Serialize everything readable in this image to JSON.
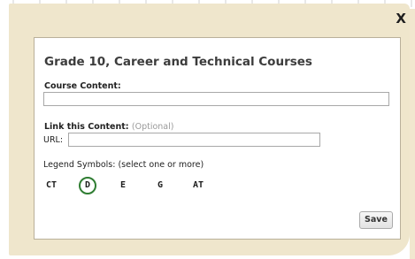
{
  "modal": {
    "close_label": "X",
    "title": "Grade 10, Career and Technical Courses",
    "course_content_label": "Course Content:",
    "course_content_value": "",
    "link_label": "Link this Content:",
    "link_optional": "(Optional)",
    "url_label": "URL:",
    "url_value": "",
    "legend_label": "Legend Symbols: (select one or more)",
    "legend_symbols": [
      {
        "label": "CT",
        "selected": false
      },
      {
        "label": "D",
        "selected": true
      },
      {
        "label": "E",
        "selected": false
      },
      {
        "label": "G",
        "selected": false
      },
      {
        "label": "AT",
        "selected": false
      }
    ],
    "save_label": "Save"
  },
  "colors": {
    "frame": "#efe6cc",
    "selected_ring": "#2f7d32"
  }
}
